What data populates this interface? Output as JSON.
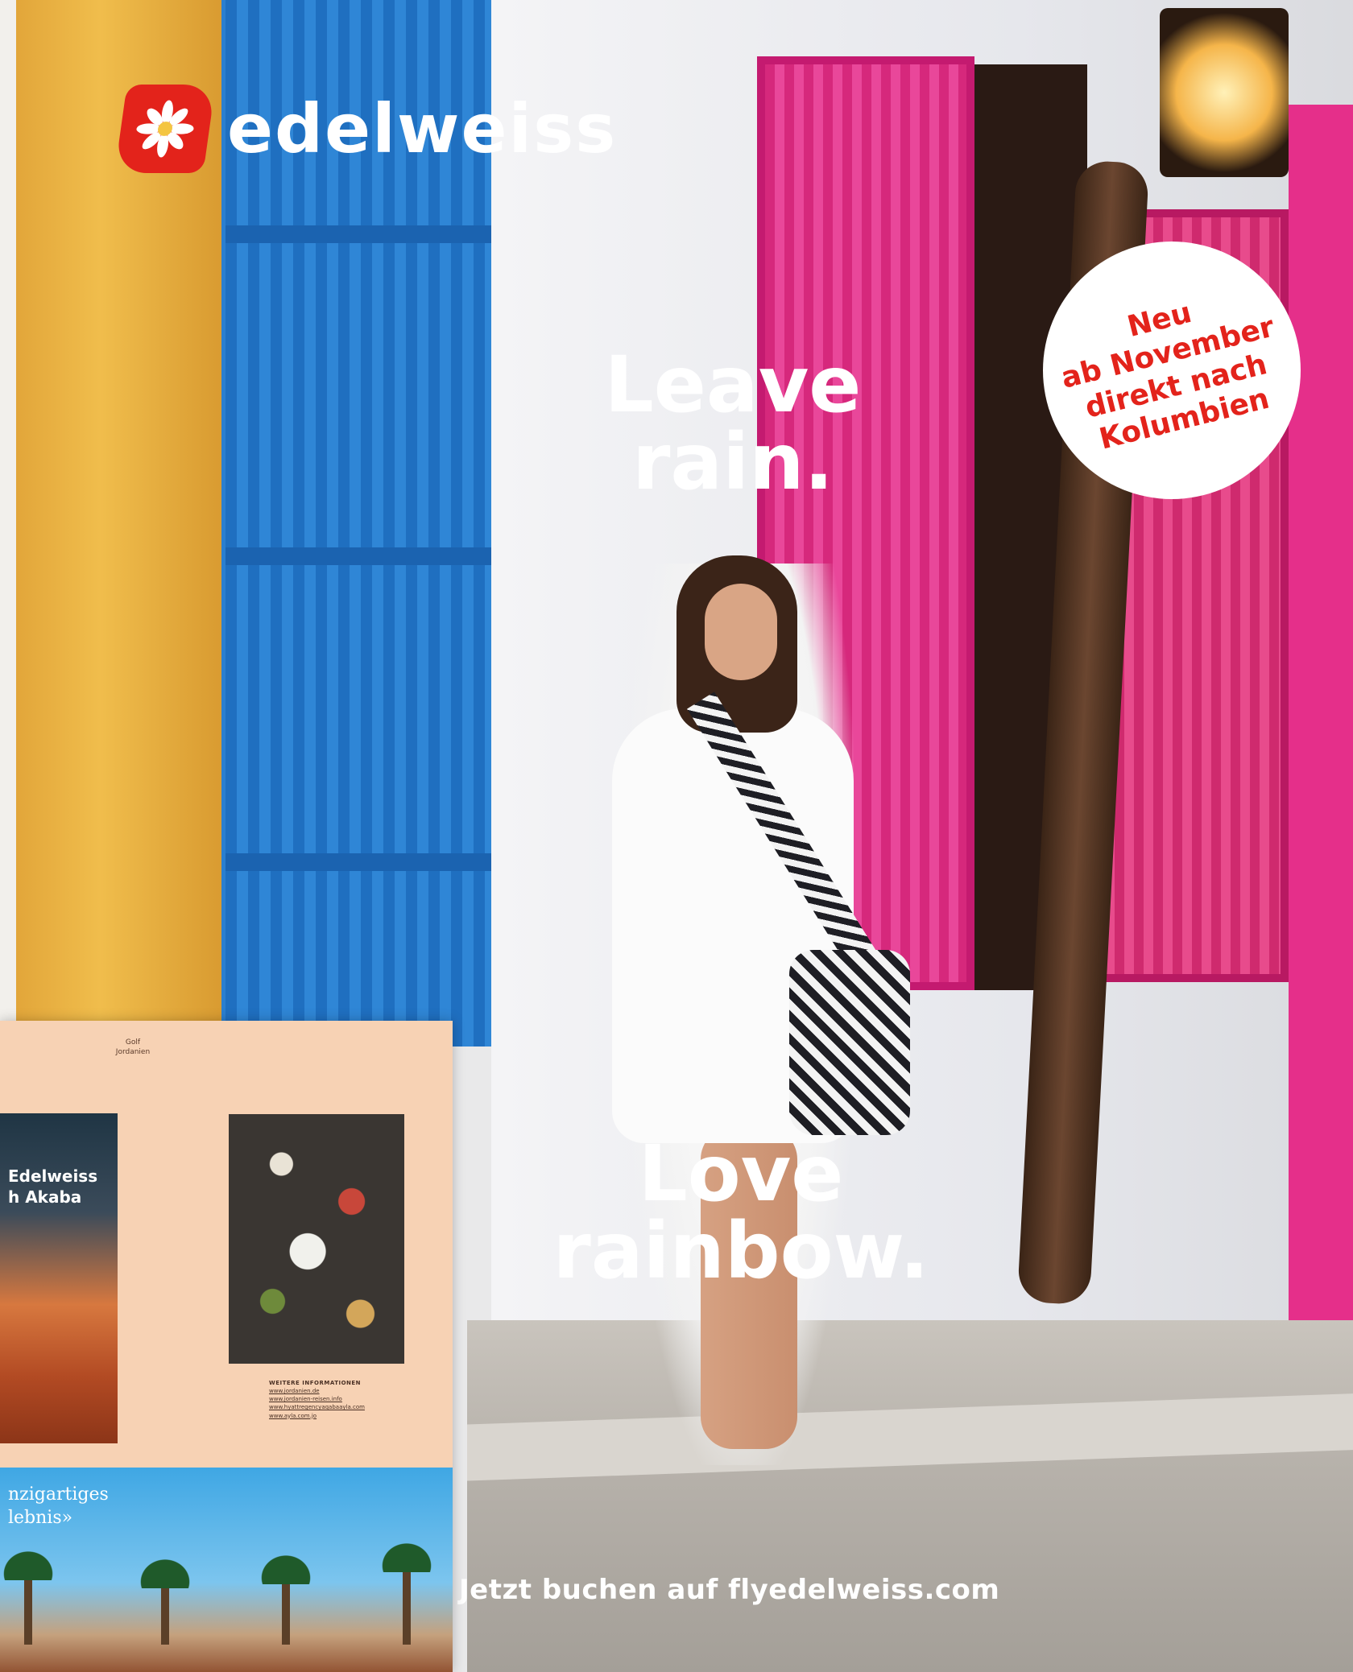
{
  "brand": {
    "name": "edelweiss",
    "logo_color": "#e3231b"
  },
  "ad": {
    "headline_top": [
      "Leave",
      "rain."
    ],
    "headline_bottom": [
      "Love",
      "rainbow."
    ],
    "badge_lines": [
      "Neu",
      "ab November",
      "direkt nach",
      "Kolumbien"
    ],
    "cta": "Jetzt buchen auf flyedelweiss.com"
  },
  "brochure": {
    "header_lines": [
      "Golf",
      "Jordanien"
    ],
    "left_panel_title": [
      "Edelweiss",
      "h Akaba"
    ],
    "info_heading": "WEITERE INFORMATIONEN",
    "info_links": [
      "www.jordanien.de",
      "www.jordanien-reisen.info",
      "www.hyattregencyaqabaayla.com",
      "www.ayla.com.jo"
    ],
    "bottom_title": [
      "nzigartiges",
      "lebnis»"
    ]
  },
  "colors": {
    "accent_red": "#e3231b",
    "brochure_bg": "#f7d2b4"
  }
}
